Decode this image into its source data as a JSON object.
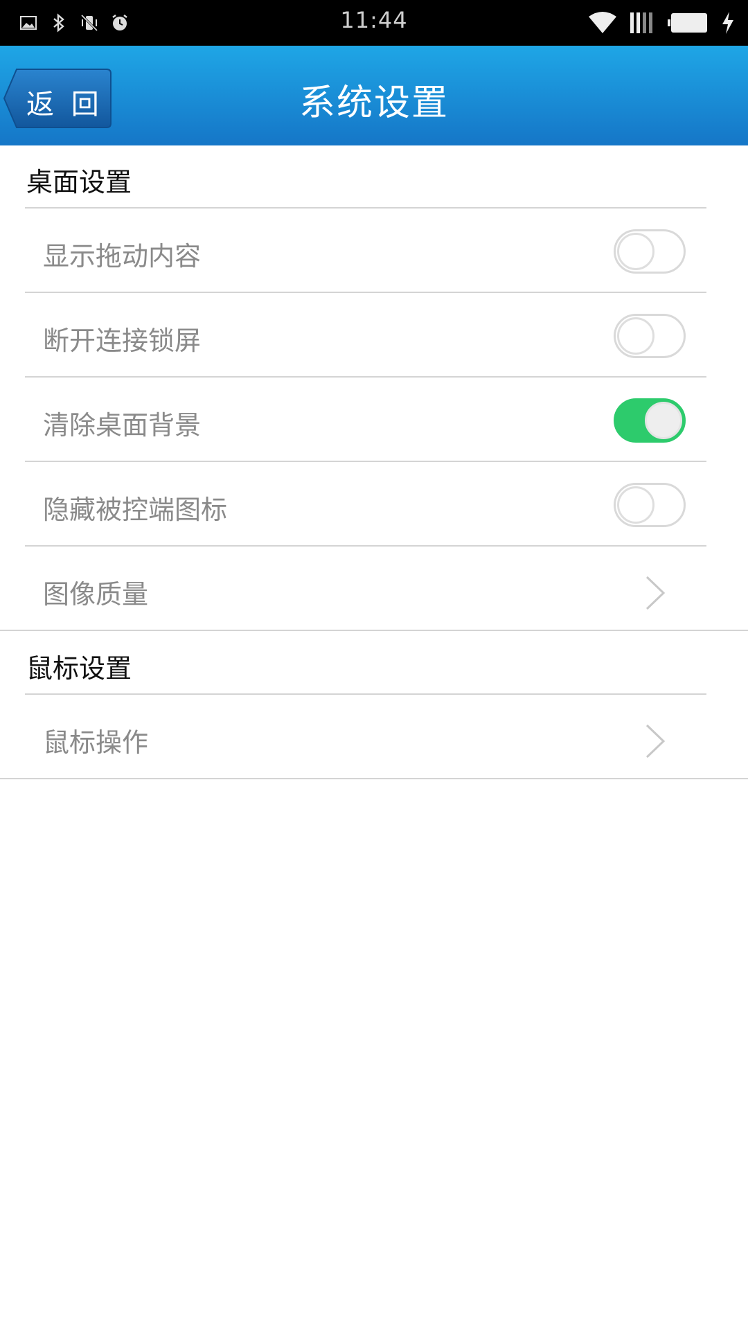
{
  "status_bar": {
    "time": "11:44",
    "left_icons": [
      "image-icon",
      "bluetooth-icon",
      "vibrate-icon",
      "alarm-icon"
    ],
    "right_icons": [
      "wifi-icon",
      "signal-icon",
      "battery-icon",
      "charging-icon"
    ]
  },
  "header": {
    "back_label": "返 回",
    "title": "系统设置",
    "colors": {
      "gradient_top": "#1fa6e6",
      "gradient_bottom": "#1576c7"
    }
  },
  "sections": [
    {
      "title": "桌面设置",
      "items": [
        {
          "label": "显示拖动内容",
          "type": "toggle",
          "value": false
        },
        {
          "label": "断开连接锁屏",
          "type": "toggle",
          "value": false
        },
        {
          "label": "清除桌面背景",
          "type": "toggle",
          "value": true
        },
        {
          "label": "隐藏被控端图标",
          "type": "toggle",
          "value": false
        },
        {
          "label": "图像质量",
          "type": "chevron",
          "icon": "chevron-right-icon"
        }
      ]
    },
    {
      "title": "鼠标设置",
      "items": [
        {
          "label": "鼠标操作",
          "type": "chevron",
          "icon": "chevron-right-icon"
        }
      ]
    }
  ],
  "colors": {
    "toggle_on": "#2dcb6c",
    "label_text": "#8a8a8a",
    "section_text": "#111111"
  }
}
